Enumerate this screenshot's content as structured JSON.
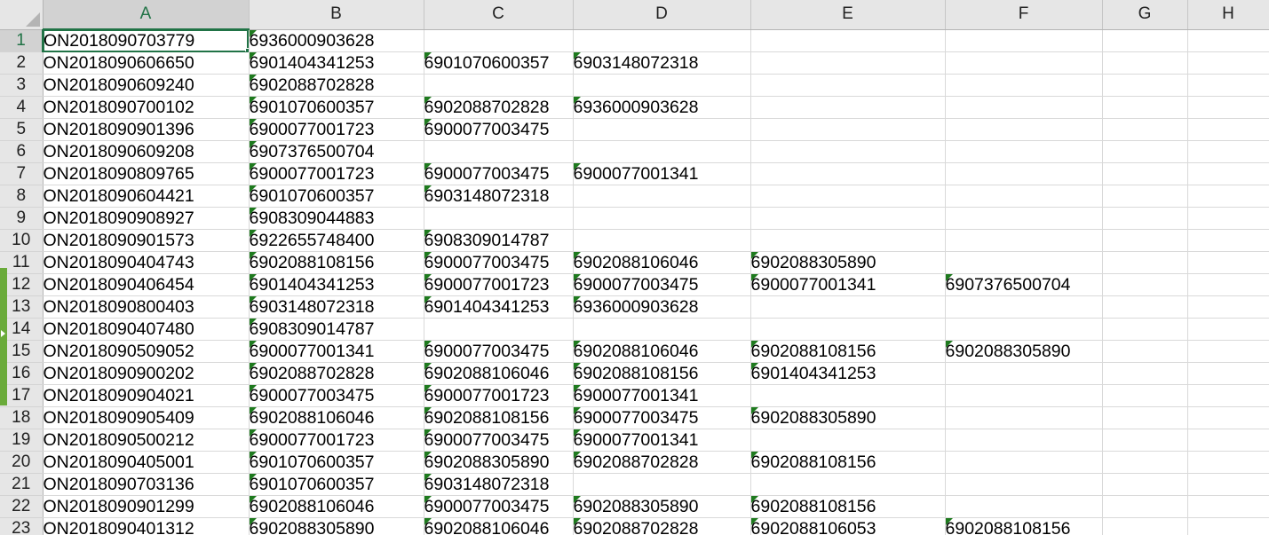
{
  "sheet": {
    "columns": [
      "A",
      "B",
      "C",
      "D",
      "E",
      "F",
      "G",
      "H"
    ],
    "active_column": "A",
    "active_row": "1",
    "rows": [
      {
        "num": "1",
        "cells": [
          "ON2018090703779",
          "6936000903628",
          "",
          "",
          "",
          "",
          "",
          ""
        ]
      },
      {
        "num": "2",
        "cells": [
          "ON2018090606650",
          "6901404341253",
          "6901070600357",
          "6903148072318",
          "",
          "",
          "",
          ""
        ]
      },
      {
        "num": "3",
        "cells": [
          "ON2018090609240",
          "6902088702828",
          "",
          "",
          "",
          "",
          "",
          ""
        ]
      },
      {
        "num": "4",
        "cells": [
          "ON2018090700102",
          "6901070600357",
          "6902088702828",
          "6936000903628",
          "",
          "",
          "",
          ""
        ]
      },
      {
        "num": "5",
        "cells": [
          "ON2018090901396",
          "6900077001723",
          "6900077003475",
          "",
          "",
          "",
          "",
          ""
        ]
      },
      {
        "num": "6",
        "cells": [
          "ON2018090609208",
          "6907376500704",
          "",
          "",
          "",
          "",
          "",
          ""
        ]
      },
      {
        "num": "7",
        "cells": [
          "ON2018090809765",
          "6900077001723",
          "6900077003475",
          "6900077001341",
          "",
          "",
          "",
          ""
        ]
      },
      {
        "num": "8",
        "cells": [
          "ON2018090604421",
          "6901070600357",
          "6903148072318",
          "",
          "",
          "",
          "",
          ""
        ]
      },
      {
        "num": "9",
        "cells": [
          "ON2018090908927",
          "6908309044883",
          "",
          "",
          "",
          "",
          "",
          ""
        ]
      },
      {
        "num": "10",
        "cells": [
          "ON2018090901573",
          "6922655748400",
          "6908309014787",
          "",
          "",
          "",
          "",
          ""
        ]
      },
      {
        "num": "11",
        "cells": [
          "ON2018090404743",
          "6902088108156",
          "6900077003475",
          "6902088106046",
          "6902088305890",
          "",
          "",
          ""
        ]
      },
      {
        "num": "12",
        "cells": [
          "ON2018090406454",
          "6901404341253",
          "6900077001723",
          "6900077003475",
          "6900077001341",
          "6907376500704",
          "",
          ""
        ]
      },
      {
        "num": "13",
        "cells": [
          "ON2018090800403",
          "6903148072318",
          "6901404341253",
          "6936000903628",
          "",
          "",
          "",
          ""
        ]
      },
      {
        "num": "14",
        "cells": [
          "ON2018090407480",
          "6908309014787",
          "",
          "",
          "",
          "",
          "",
          ""
        ]
      },
      {
        "num": "15",
        "cells": [
          "ON2018090509052",
          "6900077001341",
          "6900077003475",
          "6902088106046",
          "6902088108156",
          "6902088305890",
          "",
          ""
        ]
      },
      {
        "num": "16",
        "cells": [
          "ON2018090900202",
          "6902088702828",
          "6902088106046",
          "6902088108156",
          "6901404341253",
          "",
          "",
          ""
        ]
      },
      {
        "num": "17",
        "cells": [
          "ON2018090904021",
          "6900077003475",
          "6900077001723",
          "6900077001341",
          "",
          "",
          "",
          ""
        ]
      },
      {
        "num": "18",
        "cells": [
          "ON2018090905409",
          "6902088106046",
          "6902088108156",
          "6900077003475",
          "6902088305890",
          "",
          "",
          ""
        ]
      },
      {
        "num": "19",
        "cells": [
          "ON2018090500212",
          "6900077001723",
          "6900077003475",
          "6900077001341",
          "",
          "",
          "",
          ""
        ]
      },
      {
        "num": "20",
        "cells": [
          "ON2018090405001",
          "6901070600357",
          "6902088305890",
          "6902088702828",
          "6902088108156",
          "",
          "",
          ""
        ]
      },
      {
        "num": "21",
        "cells": [
          "ON2018090703136",
          "6901070600357",
          "6903148072318",
          "",
          "",
          "",
          "",
          ""
        ]
      },
      {
        "num": "22",
        "cells": [
          "ON2018090901299",
          "6902088106046",
          "6900077003475",
          "6902088305890",
          "6902088108156",
          "",
          "",
          ""
        ]
      },
      {
        "num": "23",
        "cells": [
          "ON2018090401312",
          "6902088305890",
          "6902088106046",
          "6902088702828",
          "6902088106053",
          "6902088108156",
          "",
          ""
        ]
      }
    ]
  },
  "colors": {
    "accent": "#217346",
    "text_flag": "#1e7a1e",
    "sheet_tab": "#6aab3a"
  }
}
